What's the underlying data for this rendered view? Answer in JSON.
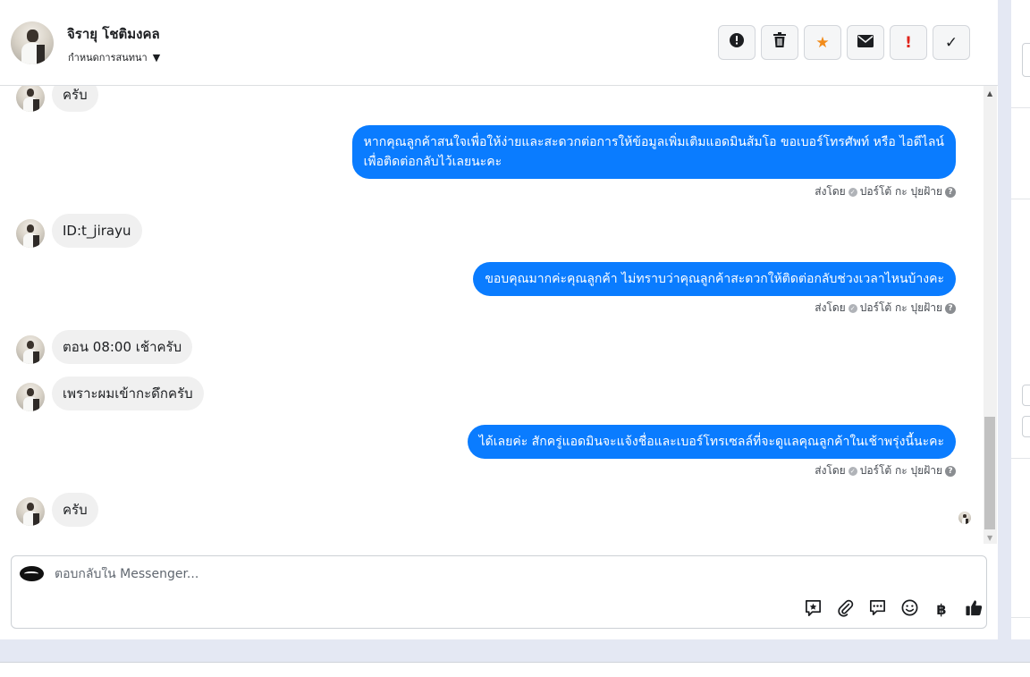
{
  "header": {
    "contact_name": "จิรายุ โชติมงคล",
    "subtitle": "กำหนดการสนทนา",
    "actions": [
      {
        "icon": "alert-circle-icon",
        "glyph": "!"
      },
      {
        "icon": "trash-icon",
        "glyph": ""
      },
      {
        "icon": "star-icon",
        "glyph": "★"
      },
      {
        "icon": "envelope-icon",
        "glyph": ""
      },
      {
        "icon": "exclamation-icon",
        "glyph": "!"
      },
      {
        "icon": "check-icon",
        "glyph": "✓"
      }
    ]
  },
  "messages": [
    {
      "dir": "in",
      "text": "ครับ"
    },
    {
      "dir": "out",
      "line1": "หากคุณลูกค้าสนใจเพื่อให้ง่ายและสะดวกต่อการให้ข้อมูลเพิ่มเติมแอดมินส้มโอ ขอเบอร์โทรศัพท์ หรือ ไอดีไลน์",
      "line2": "เพื่อติดต่อกลับไว้เลยนะคะ"
    },
    {
      "dir": "in",
      "text": "ID:t_jirayu"
    },
    {
      "dir": "out",
      "line1": "ขอบคุณมากค่ะคุณลูกค้า ไม่ทราบว่าคุณลูกค้าสะดวกให้ติดต่อกลับช่วงเวลาไหนบ้างคะ"
    },
    {
      "dir": "in",
      "text": "ตอน 08:00 เช้าครับ"
    },
    {
      "dir": "in",
      "text": "เพราะผมเข้ากะดึกครับ"
    },
    {
      "dir": "out",
      "line1": "ได้เลยค่ะ สักครู่แอดมินจะแจ้งชื่อและเบอร์โทรเซลล์ที่จะดูแลคุณลูกค้าในเช้าพรุ่งนี้นะคะ"
    },
    {
      "dir": "in",
      "text": "ครับ"
    }
  ],
  "sent_by": {
    "prefix": "ส่งโดย",
    "agent": "ปอร์โต้ กะ ปุยฝ้าย",
    "help_glyph": "?"
  },
  "composer": {
    "placeholder": "ตอบกลับใน Messenger...",
    "tools": [
      "saved-reply-icon",
      "attachment-icon",
      "chat-bubbles-icon",
      "emoji-icon",
      "baht-icon",
      "thumbs-up-icon"
    ],
    "baht_glyph": "฿"
  },
  "colors": {
    "outgoing_bubble": "#0a7cff",
    "incoming_bubble": "#f0f0f0",
    "star": "#f28b1a",
    "alert_red": "#e0241b"
  }
}
